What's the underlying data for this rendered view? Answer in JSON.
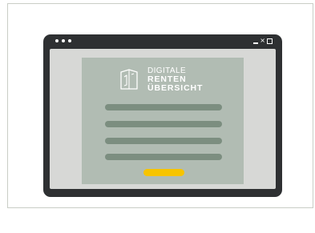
{
  "brand": {
    "line1": "DIGITALE",
    "line2": "RENTEN",
    "line3": "ÜBERSICHT"
  },
  "window_controls": {
    "close_glyph": "×"
  },
  "form": {
    "field_count": 4,
    "submit_button_color": "#f7c400"
  },
  "colors": {
    "device_frame": "#2e3032",
    "screen_background": "#d7d8d6",
    "panel": "#b1bcb3",
    "field": "#7c8e80",
    "accent": "#f7c400"
  },
  "icons": [
    "document-shield-icon",
    "minimize-icon",
    "close-icon",
    "maximize-icon"
  ]
}
